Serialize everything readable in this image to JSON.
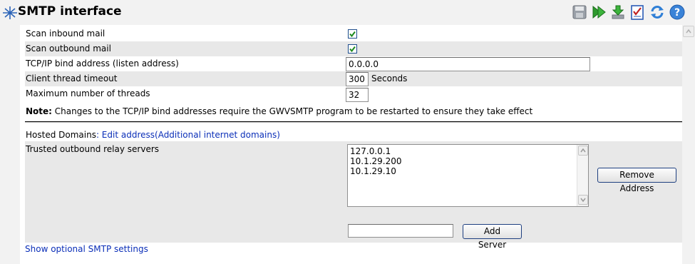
{
  "header": {
    "title": "SMTP interface",
    "toolbar_icons": [
      "save-icon",
      "run-icon",
      "download-icon",
      "checklist-icon",
      "refresh-icon",
      "help-icon"
    ]
  },
  "settings": {
    "scan_inbound": {
      "label": "Scan inbound mail",
      "checked": true
    },
    "scan_outbound": {
      "label": "Scan outbound mail",
      "checked": true
    },
    "bind_address": {
      "label": "TCP/IP bind address (listen address)",
      "value": "0.0.0.0"
    },
    "thread_timeout": {
      "label": "Client thread timeout",
      "value": "300",
      "unit": "Seconds"
    },
    "max_threads": {
      "label": "Maximum number of threads",
      "value": "32"
    }
  },
  "note": {
    "prefix": "Note:",
    "text": " Changes to the TCP/IP bind addresses require the GWVSMTP program to be restarted to ensure they take effect"
  },
  "hosted": {
    "label": "Hosted Domains",
    "link": ": Edit address(Additional internet domains)"
  },
  "relay": {
    "label": "Trusted outbound relay servers",
    "servers": [
      "127.0.0.1",
      "10.1.29.200",
      "10.1.29.10"
    ],
    "remove_button": "Remove Address",
    "new_server_value": "",
    "add_button": "Add Server"
  },
  "footer": {
    "show_optional": "Show optional SMTP settings"
  },
  "colors": {
    "link": "#0b2fb8",
    "checkbox_check": "#1e8a1e",
    "row_shade": "#e8e8e8"
  }
}
